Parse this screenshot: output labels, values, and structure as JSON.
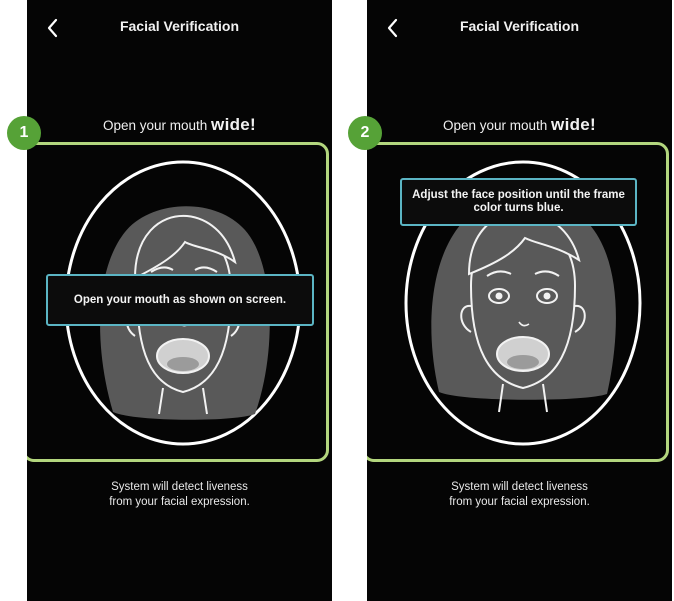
{
  "screens": [
    {
      "back_icon": "chevron-left-icon",
      "title": "Facial Verification",
      "instruction_prefix": "Open your mouth ",
      "instruction_emphasis": "wide!",
      "tooltip": "Open your mouth as shown on screen.",
      "bottom_text": "System will detect liveness\nfrom your facial expression.",
      "step_badge": "1"
    },
    {
      "back_icon": "chevron-left-icon",
      "title": "Facial Verification",
      "instruction_prefix": "Open your mouth ",
      "instruction_emphasis": "wide!",
      "tooltip": "Adjust the face position until the frame color turns blue.",
      "bottom_text": "System will detect liveness\nfrom your facial expression.",
      "step_badge": "2"
    }
  ],
  "colors": {
    "frame_border": "#b3d67e",
    "badge": "#56a237",
    "tooltip_border": "#5bb5c4",
    "screen_bg": "#050505"
  }
}
